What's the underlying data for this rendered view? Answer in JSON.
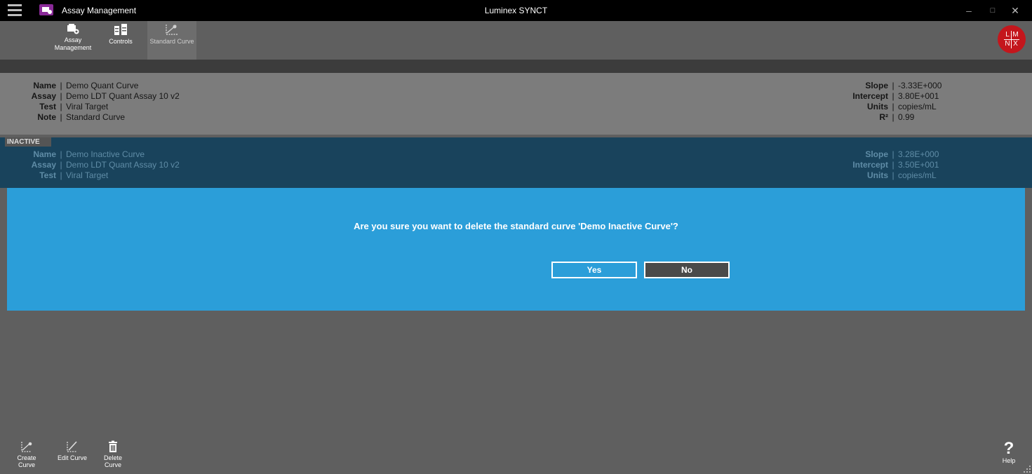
{
  "titlebar": {
    "module_title": "Assay Management",
    "window_title": "Luminex SYNCT",
    "minimize": "–",
    "maximize": "□",
    "close": "✕"
  },
  "toolbar": {
    "assay_management_label": "Assay Management",
    "controls_label": "Controls",
    "standard_curve_label": "Standard Curve",
    "selected": "Standard Curve"
  },
  "logo": {
    "letters": [
      "L",
      "M",
      "N",
      "X"
    ],
    "color": "#c4161c"
  },
  "curves": [
    {
      "status": "",
      "fields": [
        {
          "key": "Name",
          "value": "Demo Quant Curve"
        },
        {
          "key": "Assay",
          "value": "Demo LDT Quant Assay 10 v2"
        },
        {
          "key": "Test",
          "value": "Viral Target"
        },
        {
          "key": "Note",
          "value": "Standard Curve"
        }
      ],
      "stats": [
        {
          "key": "Slope",
          "value": "-3.33E+000"
        },
        {
          "key": "Intercept",
          "value": "3.80E+001"
        },
        {
          "key": "Units",
          "value": "copies/mL"
        },
        {
          "key": "R²",
          "value": "0.99"
        }
      ]
    },
    {
      "status": "INACTIVE",
      "fields": [
        {
          "key": "Name",
          "value": "Demo Inactive Curve"
        },
        {
          "key": "Assay",
          "value": "Demo LDT Quant Assay 10 v2"
        },
        {
          "key": "Test",
          "value": "Viral Target"
        }
      ],
      "stats": [
        {
          "key": "Slope",
          "value": "3.28E+000"
        },
        {
          "key": "Intercept",
          "value": "3.50E+001"
        },
        {
          "key": "Units",
          "value": "copies/mL"
        }
      ]
    }
  ],
  "dialog": {
    "message": "Are you sure you want to delete the standard curve 'Demo Inactive Curve'?",
    "yes_label": "Yes",
    "no_label": "No"
  },
  "bottom_toolbar": {
    "create_label": "Create Curve",
    "edit_label": "Edit Curve",
    "delete_label": "Delete Curve",
    "help_label": "Help",
    "help_glyph": "?"
  },
  "colors": {
    "dialog_bg": "#2b9ed9",
    "selected_row": "#19435c",
    "background": "#5f5f5f"
  }
}
